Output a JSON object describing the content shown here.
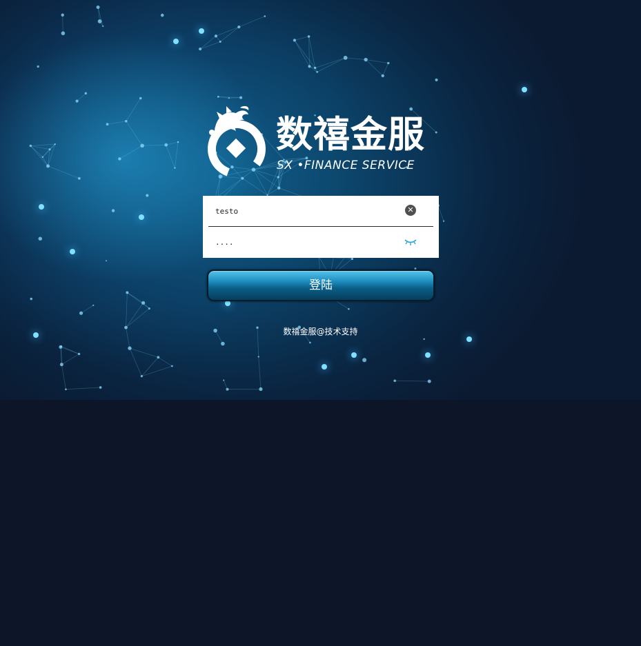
{
  "brand": {
    "name_cn": "数禧金服",
    "name_en": "SX •FINANCE SERVICE"
  },
  "form": {
    "username_value": "testo",
    "password_value": "....",
    "clear_icon": "close-circle-icon",
    "eye_icon": "eye-closed-icon"
  },
  "login_button": {
    "label": "登陆"
  },
  "footer": {
    "text": "数禧金服@技术支持"
  },
  "colors": {
    "background": "#0c1628",
    "hero_glow": "#1a8fd0",
    "button": "#1e8fc0",
    "eye_icon": "#2a9fd6"
  }
}
